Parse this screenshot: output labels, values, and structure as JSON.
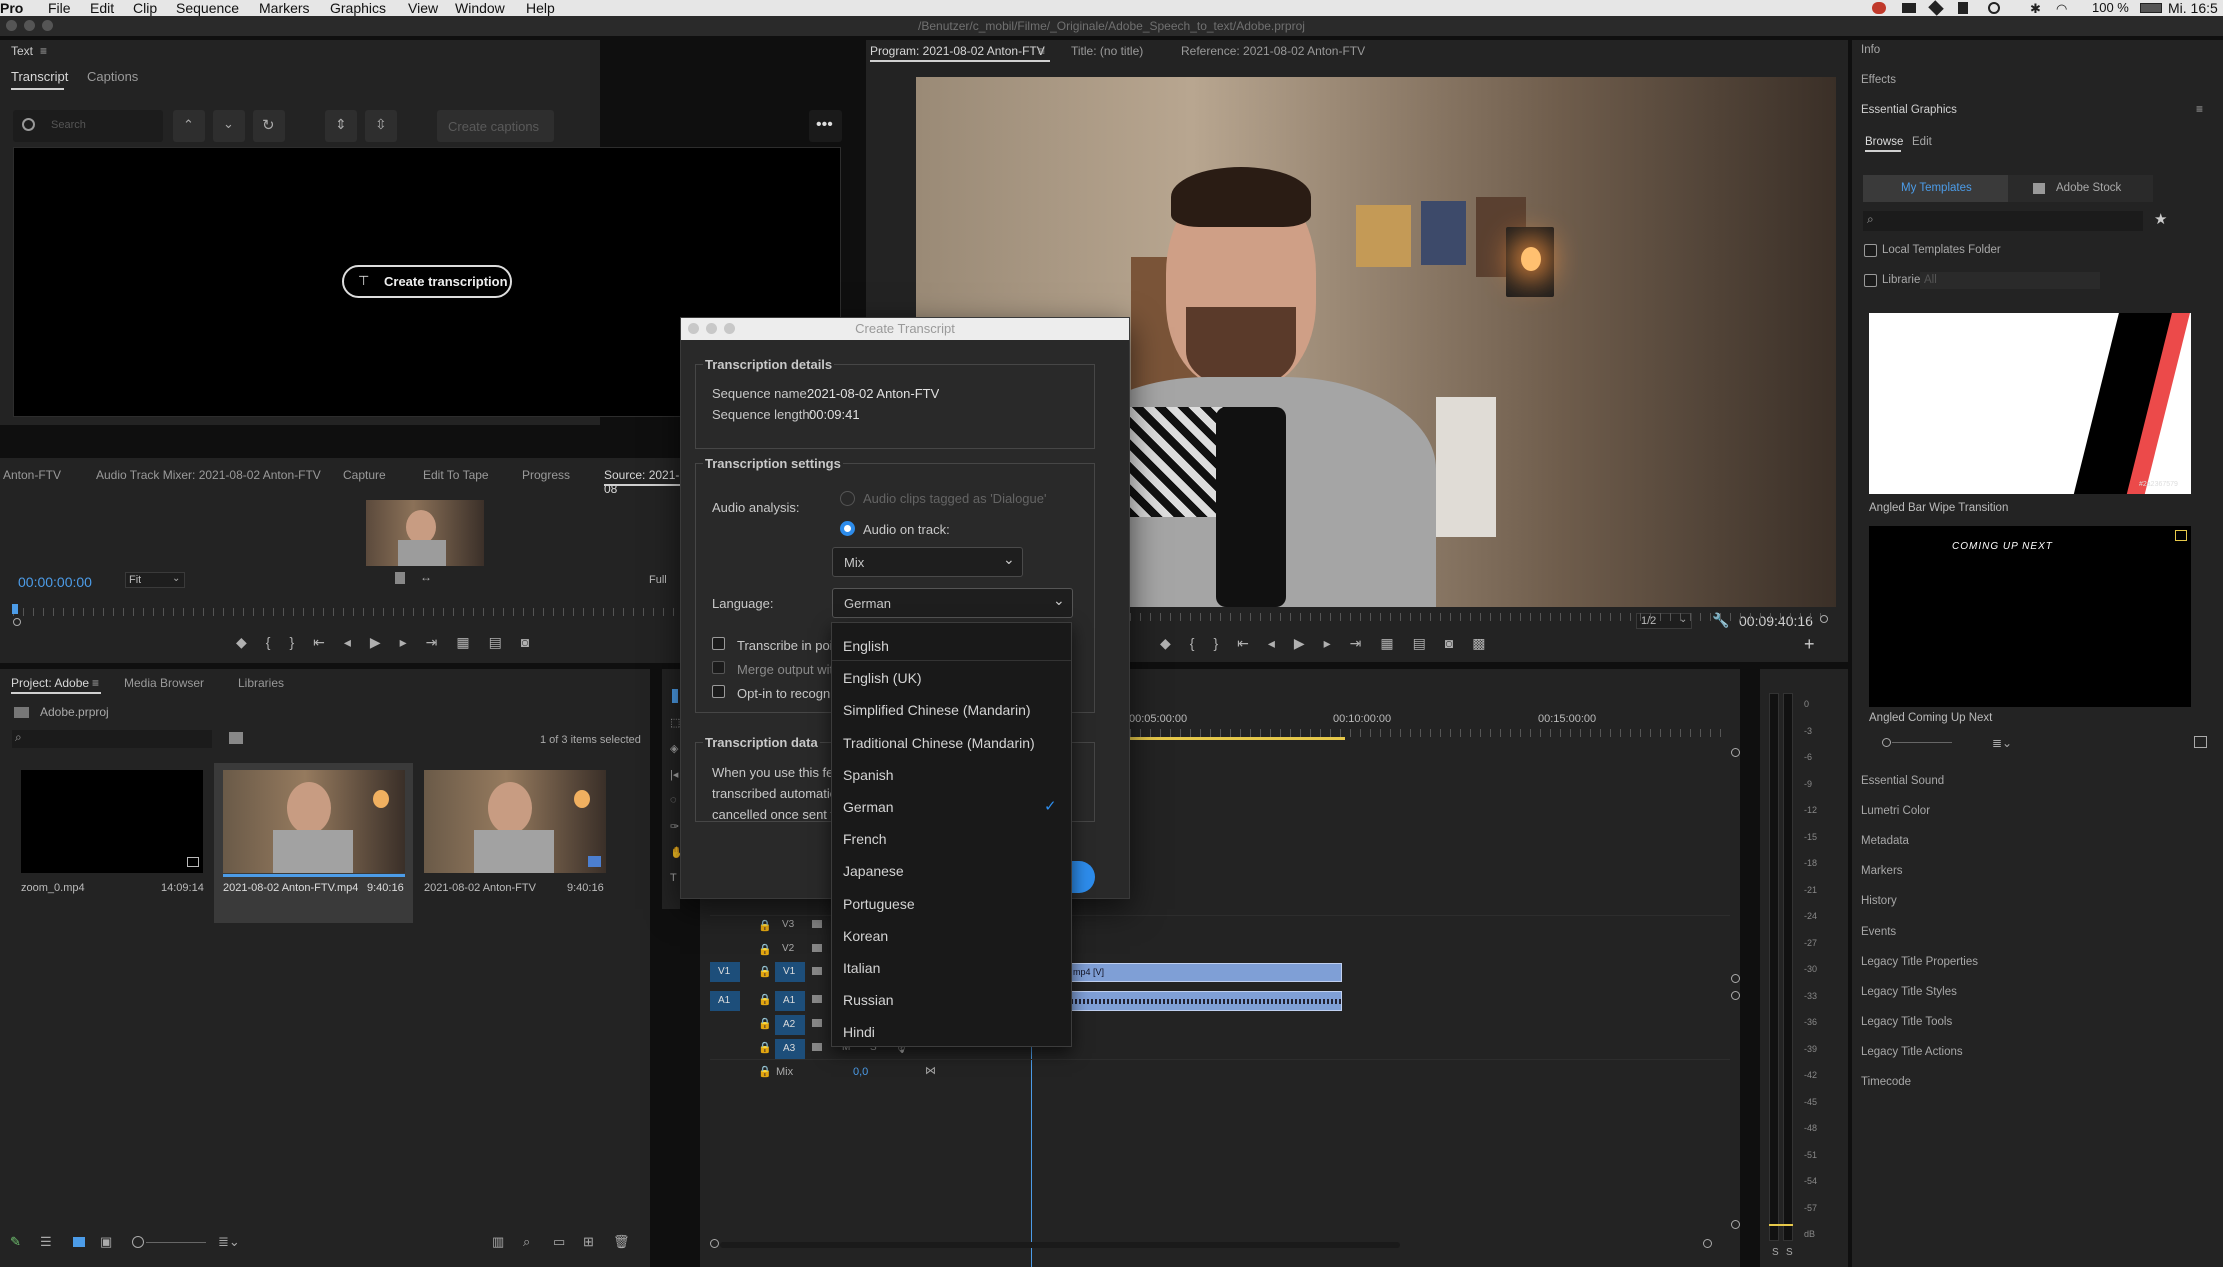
{
  "menubar": {
    "app": "Pro",
    "items": [
      "File",
      "Edit",
      "Clip",
      "Sequence",
      "Markers",
      "Graphics",
      "View",
      "Window",
      "Help"
    ],
    "battery": "100 %",
    "clock": "Mi. 16:5"
  },
  "path": "/Benutzer/c_mobil/Filme/_Originale/Adobe_Speech_to_text/Adobe.prproj",
  "text_panel": {
    "title": "Text",
    "tabs": [
      "Transcript",
      "Captions"
    ],
    "search_placeholder": "Search",
    "create_captions": "Create captions",
    "create_transcription": "Create transcription"
  },
  "source_tabs": [
    "Anton-FTV",
    "Audio Track Mixer: 2021-08-02 Anton-FTV",
    "Capture",
    "Edit To Tape",
    "Progress",
    "Source: 2021-08"
  ],
  "source": {
    "timecode": "00:00:00:00",
    "fit": "Fit",
    "full": "Full"
  },
  "program": {
    "tabs": [
      "Program: 2021-08-02 Anton-FTV",
      "Title: (no title)",
      "Reference: 2021-08-02 Anton-FTV"
    ],
    "zoom": "1/2",
    "duration": "00:09:40:16"
  },
  "project": {
    "tabs": [
      "Project: Adobe",
      "Media Browser",
      "Libraries"
    ],
    "file": "Adobe.prproj",
    "selection": "1 of 3 items selected",
    "items": [
      {
        "name": "zoom_0.mp4",
        "duration": "14:09:14"
      },
      {
        "name": "2021-08-02 Anton-FTV.mp4",
        "duration": "9:40:16"
      },
      {
        "name": "2021-08-02 Anton-FTV",
        "duration": "9:40:16"
      }
    ]
  },
  "timeline": {
    "ruler": [
      "00:05:00:00",
      "00:10:00:00",
      "00:15:00:00"
    ],
    "video_tracks": [
      "V3",
      "V2",
      "V1"
    ],
    "audio_tracks": [
      "A1",
      "A2",
      "A3"
    ],
    "src_v": "V1",
    "src_a": "A1",
    "mix_label": "Mix",
    "mix_value": "0,0",
    "clip_label": "mp4 [V]",
    "mute": "M",
    "solo": "S"
  },
  "meter": {
    "scale": [
      "0",
      "-3",
      "-6",
      "-9",
      "-12",
      "-15",
      "-18",
      "-21",
      "-24",
      "-27",
      "-30",
      "-33",
      "-36",
      "-39",
      "-42",
      "-45",
      "-48",
      "-51",
      "-54",
      "-57",
      "dB"
    ],
    "solo": "S"
  },
  "right_panel": {
    "info": "Info",
    "effects": "Effects",
    "eg_title": "Essential Graphics",
    "tabs": [
      "Browse",
      "Edit"
    ],
    "my_templates": "My Templates",
    "adobe_stock": "Adobe Stock",
    "local_folder": "Local Templates Folder",
    "libraries": "Libraries",
    "all": "All",
    "template1": "Angled Bar Wipe Transition",
    "template1_code": "#2a2367579",
    "template2": "Angled Coming Up Next",
    "template2_text": "COMING UP NEXT",
    "sections": [
      "Essential Sound",
      "Lumetri Color",
      "Metadata",
      "Markers",
      "History",
      "Events",
      "Legacy Title Properties",
      "Legacy Title Styles",
      "Legacy Title Tools",
      "Legacy Title Actions",
      "Timecode"
    ]
  },
  "dialog": {
    "title": "Create Transcript",
    "details_heading": "Transcription details",
    "sequence_name_label": "Sequence name:",
    "sequence_name": "2021-08-02 Anton-FTV",
    "sequence_length_label": "Sequence length:",
    "sequence_length": "00:09:41",
    "settings_heading": "Transcription settings",
    "audio_analysis_label": "Audio analysis:",
    "option_dialogue": "Audio clips tagged as 'Dialogue'",
    "option_track": "Audio on track:",
    "track_value": "Mix",
    "language_label": "Language:",
    "language_value": "German",
    "check1": "Transcribe in point",
    "check2": "Merge output wit",
    "check3": "Opt-in to recogni",
    "data_heading": "Transcription data",
    "data_text1": "When you use this fea",
    "data_text2": "transcribed automatic",
    "data_text3": "cancelled once sent fo",
    "button_tail": "e"
  },
  "languages": [
    "English",
    "English (UK)",
    "Simplified Chinese (Mandarin)",
    "Traditional Chinese (Mandarin)",
    "Spanish",
    "German",
    "French",
    "Japanese",
    "Portuguese",
    "Korean",
    "Italian",
    "Russian",
    "Hindi"
  ],
  "selected_language": "German",
  "colors": {
    "accent": "#2d8ceb",
    "track_blue": "#1d4e7a",
    "clip_video": "#7f9fd6",
    "yellow": "#e6c84a"
  }
}
